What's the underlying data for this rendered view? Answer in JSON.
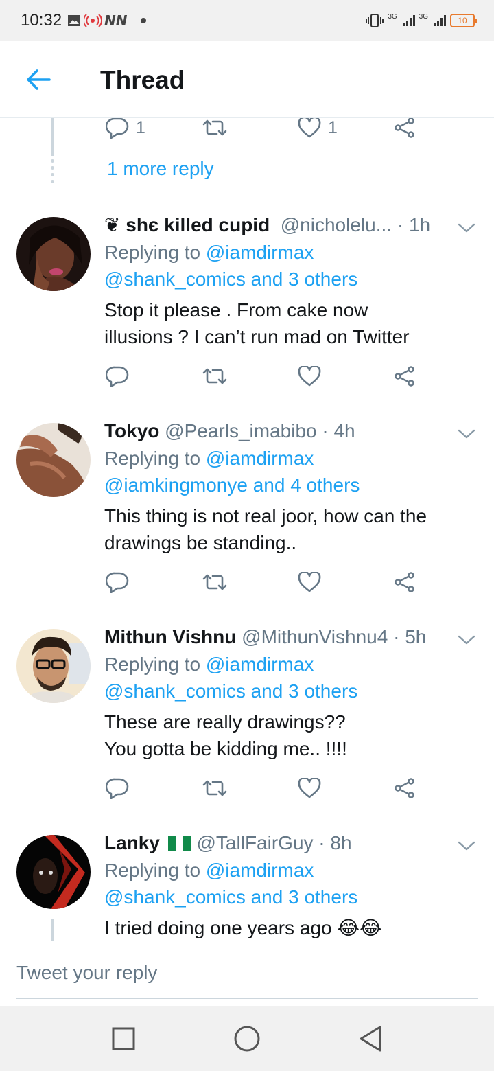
{
  "status_bar": {
    "time": "10:32",
    "network_1": "3G",
    "network_2": "3G",
    "battery": "10"
  },
  "header": {
    "title": "Thread"
  },
  "partial_tweet": {
    "reply_count": "1",
    "like_count": "1",
    "more_replies": "1 more reply"
  },
  "tweets": [
    {
      "name": "❦ shє killed cupid ⁣",
      "handle": "@nicholelu...",
      "time": "1h",
      "replying_prefix": "Replying to",
      "mention_1": "@iamdirmax",
      "mention_2": "@shank_comics and 3 others",
      "text": "Stop it please . From cake now\nillusions ? I can’t run mad on Twitter"
    },
    {
      "name": "Tokyo",
      "handle": "@Pearls_imabibo",
      "time": "4h",
      "replying_prefix": "Replying to",
      "mention_1": "@iamdirmax",
      "mention_2": "@iamkingmonye and 4 others",
      "text": "This thing is not real joor, how can the\ndrawings be standing.."
    },
    {
      "name": "Mithun Vishnu",
      "handle": "@MithunVishnu4",
      "time": "5h",
      "replying_prefix": "Replying to",
      "mention_1": "@iamdirmax",
      "mention_2": "@shank_comics and 3 others",
      "text": "These are really drawings??\nYou gotta be kidding me.. !!!!"
    },
    {
      "name": "Lanky",
      "handle": "@TallFairGuy",
      "time": "8h",
      "replying_prefix": "Replying to",
      "mention_1": "@iamdirmax",
      "mention_2": "@shank_comics and 3 others",
      "text": "I tried doing one years ago 😂😂"
    }
  ],
  "separator": "·",
  "reply_bar": {
    "placeholder": "Tweet your reply"
  },
  "colors": {
    "accent": "#1da1f2",
    "secondary_text": "#657786",
    "border": "#e6ecf0"
  },
  "icons": [
    "back-arrow-icon",
    "reply-icon",
    "retweet-icon",
    "like-icon",
    "share-icon",
    "caret-down-icon",
    "square-icon",
    "circle-icon",
    "triangle-back-icon"
  ]
}
